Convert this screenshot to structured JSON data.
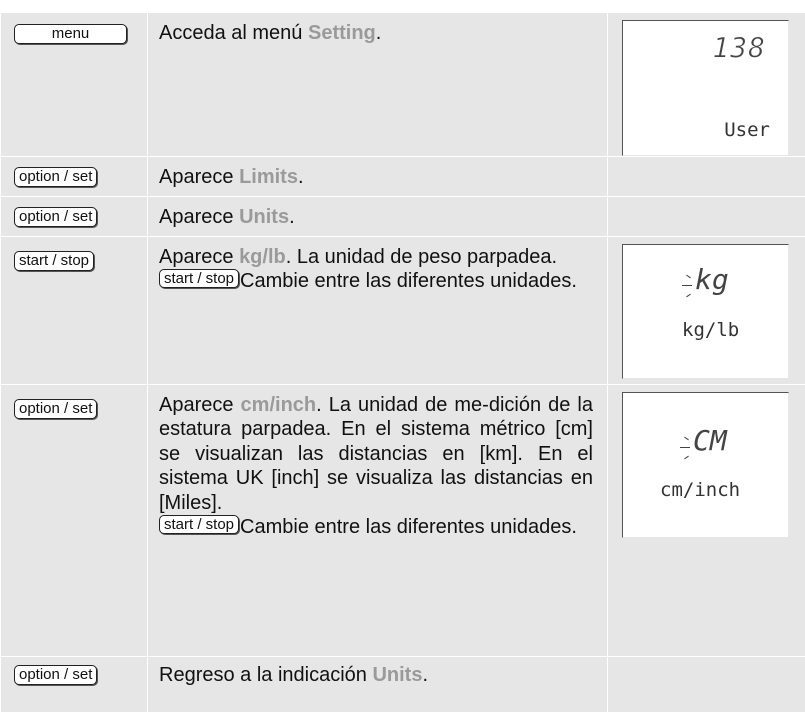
{
  "steps": [
    {
      "key": "menu",
      "text_before": "Acceda al menú ",
      "highlight": "Setting",
      "text_after": ".",
      "display": {
        "number": "138",
        "label": "User"
      }
    },
    {
      "key": "option / set",
      "text_before": "Aparece ",
      "highlight": "Limits",
      "text_after": "."
    },
    {
      "key": "option / set",
      "text_before": "Aparece ",
      "highlight": "Units",
      "text_after": "."
    },
    {
      "key": "start / stop",
      "text_before": "Aparece ",
      "highlight": "kg/lb",
      "text_after": ". La unidad de peso parpadea.",
      "inline_key": "start / stop",
      "sub_text": "Cambie entre las diferentes unidades.",
      "display": {
        "symbol": "kg",
        "label": "kg/lb"
      }
    },
    {
      "key": "option / set",
      "text_before": "Aparece ",
      "highlight": "cm/inch",
      "text_after": ". La unidad de me-dición de la estatura parpadea. En el sistema métrico [cm] se visualizan las distancias en [km]. En el sistema UK [inch] se visualiza las distancias en [Miles].",
      "inline_key": "start / stop",
      "sub_text": "Cambie entre las diferentes unidades.",
      "display": {
        "symbol": "CM",
        "label": "cm/inch"
      }
    },
    {
      "key": "option / set",
      "text_before": "Regreso a la indicación ",
      "highlight": "Units",
      "text_after": "."
    }
  ]
}
